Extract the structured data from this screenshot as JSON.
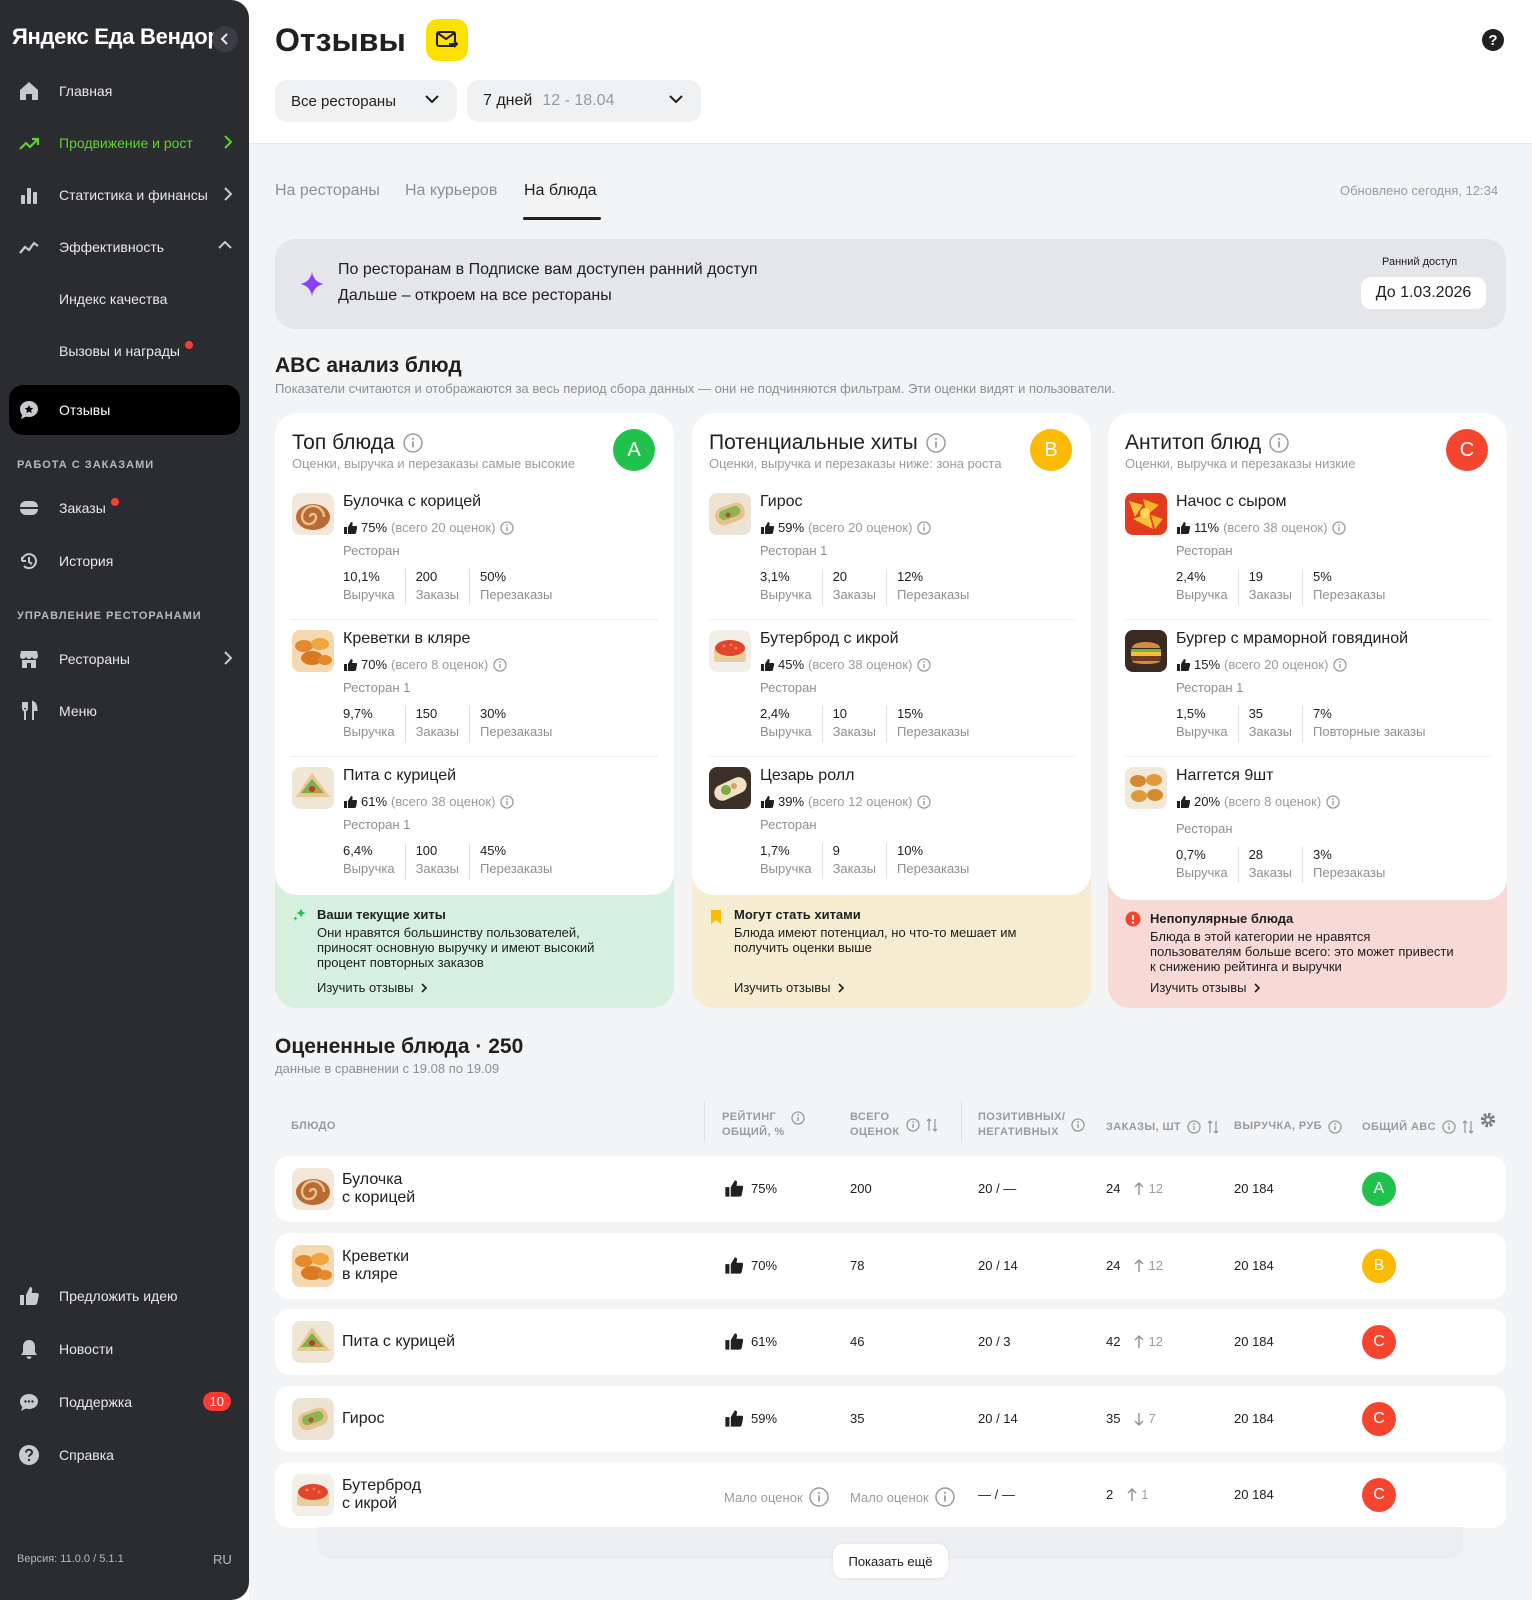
{
  "brand": "Яндекс Еда Вендор",
  "sidebar": {
    "items": [
      {
        "label": "Главная",
        "icon": "home-icon"
      },
      {
        "label": "Продвижение и рост",
        "icon": "trending-up-icon"
      },
      {
        "label": "Статистика и финансы",
        "icon": "bar-chart-icon"
      },
      {
        "label": "Эффективность",
        "icon": "efficiency-icon"
      },
      {
        "label": "Индекс качества"
      },
      {
        "label": "Вызовы и награды"
      },
      {
        "label": "Отзывы",
        "icon": "reviews-icon"
      }
    ],
    "section_orders": "РАБОТА С ЗАКАЗАМИ",
    "orders_items": [
      {
        "label": "Заказы",
        "icon": "orders-icon"
      },
      {
        "label": "История",
        "icon": "history-icon"
      }
    ],
    "section_restaurants": "УПРАВЛЕНИЕ РЕСТОРАНАМИ",
    "restaurant_items": [
      {
        "label": "Рестораны",
        "icon": "store-icon"
      },
      {
        "label": "Меню",
        "icon": "fork-knife-icon"
      }
    ],
    "bottom_items": [
      {
        "label": "Предложить идею",
        "icon": "thumb-up-icon"
      },
      {
        "label": "Новости",
        "icon": "bell-icon"
      },
      {
        "label": "Поддержка",
        "icon": "chat-icon",
        "badge": "10"
      },
      {
        "label": "Справка",
        "icon": "question-icon"
      }
    ],
    "version": "Версия: 11.0.0 / 5.1.1",
    "lang": "RU"
  },
  "header": {
    "title": "Отзывы",
    "restaurant_select": "Все рестораны",
    "period_select": "7 дней",
    "period_range": "12 - 18.04"
  },
  "tabs": [
    "На рестораны",
    "На курьеров",
    "На блюда"
  ],
  "updated": "Обновлено сегодня, 12:34",
  "banner": {
    "line1": "По ресторанам в Подписке вам доступен ранний доступ",
    "line2": "Дальше – откроем на все рестораны",
    "label": "Ранний доступ",
    "date": "До 1.03.2026"
  },
  "abc": {
    "title": "ABC анализ блюд",
    "subtitle": "Показатели считаются и отображаются за весь период сбора данных — они не подчиняются фильтрам. Эти оценки видят и пользователи.",
    "cards": [
      {
        "title": "Топ блюда",
        "subtitle": "Оценки, выручка и перезаказы самые высокие",
        "badge": "A",
        "color": "#21c24b",
        "dishes": [
          {
            "name": "Булочка с корицей",
            "pct": "75%",
            "total": "(всего 20 оценок)",
            "rest": "Ресторан",
            "m": [
              [
                "10,1%",
                "Выручка"
              ],
              [
                "200",
                "Заказы"
              ],
              [
                "50%",
                "Перезаказы"
              ]
            ]
          },
          {
            "name": "Креветки в кляре",
            "pct": "70%",
            "total": "(всего 8 оценок)",
            "rest": "Ресторан 1",
            "m": [
              [
                "9,7%",
                "Выручка"
              ],
              [
                "150",
                "Заказы"
              ],
              [
                "30%",
                "Перезаказы"
              ]
            ]
          },
          {
            "name": "Пита с курицей",
            "pct": "61%",
            "total": "(всего 38 оценок)",
            "rest": "Ресторан 1",
            "m": [
              [
                "6,4%",
                "Выручка"
              ],
              [
                "100",
                "Заказы"
              ],
              [
                "45%",
                "Перезаказы"
              ]
            ]
          }
        ],
        "bottom": {
          "title": "Ваши текущие хиты",
          "text": "Они нравятся большинству пользователей, приносят основную выручку и имеют высокий процент повторных заказов",
          "link": "Изучить отзывы"
        }
      },
      {
        "title": "Потенциальные хиты",
        "subtitle": "Оценки, выручка и перезаказы ниже: зона роста",
        "badge": "B",
        "color": "#fcba03",
        "dishes": [
          {
            "name": "Гирос",
            "pct": "59%",
            "total": "(всего 20 оценок)",
            "rest": "Ресторан 1",
            "m": [
              [
                "3,1%",
                "Выручка"
              ],
              [
                "20",
                "Заказы"
              ],
              [
                "12%",
                "Перезаказы"
              ]
            ]
          },
          {
            "name": "Бутерброд с икрой",
            "pct": "45%",
            "total": "(всего 38 оценок)",
            "rest": "Ресторан",
            "m": [
              [
                "2,4%",
                "Выручка"
              ],
              [
                "10",
                "Заказы"
              ],
              [
                "15%",
                "Перезаказы"
              ]
            ]
          },
          {
            "name": "Цезарь ролл",
            "pct": "39%",
            "total": "(всего 12 оценок)",
            "rest": "Ресторан",
            "m": [
              [
                "1,7%",
                "Выручка"
              ],
              [
                "9",
                "Заказы"
              ],
              [
                "10%",
                "Перезаказы"
              ]
            ]
          }
        ],
        "bottom": {
          "title": "Могут стать хитами",
          "text": "Блюда имеют потенциал, но что-то мешает им получить оценки выше",
          "link": "Изучить отзывы"
        }
      },
      {
        "title": "Антитоп блюд",
        "subtitle": "Оценки, выручка и перезаказы низкие",
        "badge": "C",
        "color": "#f5452e",
        "dishes": [
          {
            "name": "Начос с сыром",
            "pct": "11%",
            "total": "(всего 38 оценок)",
            "rest": "Ресторан",
            "m": [
              [
                "2,4%",
                "Выручка"
              ],
              [
                "19",
                "Заказы"
              ],
              [
                "5%",
                "Перезаказы"
              ]
            ]
          },
          {
            "name": "Бургер с мраморной говядиной",
            "pct": "15%",
            "total": "(всего 20 оценок)",
            "rest": "Ресторан 1",
            "m": [
              [
                "1,5%",
                "Выручка"
              ],
              [
                "35",
                "Заказы"
              ],
              [
                "7%",
                "Повторные заказы"
              ]
            ]
          },
          {
            "name": "Наггется 9шт",
            "pct": "20%",
            "total": "(всего 8 оценок)",
            "rest": "Ресторан",
            "m": [
              [
                "0,7%",
                "Выручка"
              ],
              [
                "28",
                "Заказы"
              ],
              [
                "3%",
                "Перезаказы"
              ]
            ]
          }
        ],
        "bottom": {
          "title": "Непопулярные блюда",
          "text": "Блюда в этой категории не нравятся пользователям больше всего: это может привести к снижению рейтинга и выручки",
          "link": "Изучить отзывы"
        }
      }
    ]
  },
  "rated": {
    "title": "Оцененные блюда · 250",
    "subtitle": "данные в сравнении с 19.08 по 19.09",
    "columns": {
      "dish": "БЛЮДО",
      "rating": [
        "РЕЙТИНГ",
        "ОБЩИЙ, %"
      ],
      "total": [
        "ВСЕГО",
        "ОЦЕНОК"
      ],
      "posneg": [
        "ПОЗИТИВНЫХ/",
        "НЕГАТИВНЫХ"
      ],
      "orders": "ЗАКАЗЫ, ШТ",
      "revenue": "ВЫРУЧКА, РУБ",
      "abc": "ОБЩИЙ ABC"
    },
    "rows": [
      {
        "name": [
          "Булочка",
          "с корицей"
        ],
        "rating": "75%",
        "total": "200",
        "posneg": "20 / —",
        "orders": "24",
        "delta": "12",
        "dir": "up",
        "revenue": "20 184",
        "abc": "A"
      },
      {
        "name": [
          "Креветки",
          "в кляре"
        ],
        "rating": "70%",
        "total": "78",
        "posneg": "20 / 14",
        "orders": "24",
        "delta": "12",
        "dir": "up",
        "revenue": "20 184",
        "abc": "B"
      },
      {
        "name": [
          "Пита с курицей"
        ],
        "rating": "61%",
        "total": "46",
        "posneg": "20 / 3",
        "orders": "42",
        "delta": "12",
        "dir": "up",
        "revenue": "20 184",
        "abc": "C"
      },
      {
        "name": [
          "Гирос"
        ],
        "rating": "59%",
        "total": "35",
        "posneg": "20 / 14",
        "orders": "35",
        "delta": "7",
        "dir": "down",
        "revenue": "20 184",
        "abc": "C"
      },
      {
        "name": [
          "Бутерброд",
          "с икрой"
        ],
        "rating_few": "Мало оценок",
        "total_few": "Мало оценок",
        "posneg": "— / —",
        "orders": "2",
        "delta": "1",
        "dir": "up",
        "revenue": "20 184",
        "abc": "C"
      }
    ],
    "show_more": "Показать ещё"
  }
}
